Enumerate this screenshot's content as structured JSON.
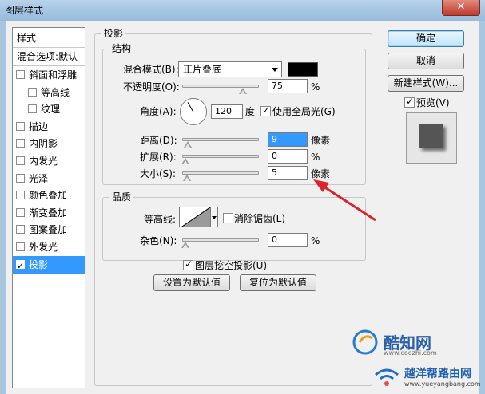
{
  "window": {
    "title": "图层样式",
    "close_label": "✕"
  },
  "sidebar": {
    "header": "样式",
    "blend_options": "混合选项:默认",
    "items": [
      {
        "label": "斜面和浮雕",
        "checked": false,
        "indent": false
      },
      {
        "label": "等高线",
        "checked": false,
        "indent": true
      },
      {
        "label": "纹理",
        "checked": false,
        "indent": true
      },
      {
        "label": "描边",
        "checked": false,
        "indent": false
      },
      {
        "label": "内阴影",
        "checked": false,
        "indent": false
      },
      {
        "label": "内发光",
        "checked": false,
        "indent": false
      },
      {
        "label": "光泽",
        "checked": false,
        "indent": false
      },
      {
        "label": "颜色叠加",
        "checked": false,
        "indent": false
      },
      {
        "label": "渐变叠加",
        "checked": false,
        "indent": false
      },
      {
        "label": "图案叠加",
        "checked": false,
        "indent": false
      },
      {
        "label": "外发光",
        "checked": false,
        "indent": false
      },
      {
        "label": "投影",
        "checked": true,
        "indent": false,
        "selected": true
      }
    ]
  },
  "drop_shadow": {
    "section_title": "投影",
    "structure": {
      "title": "结构",
      "blend_mode_label": "混合模式(B):",
      "blend_mode_value": "正片叠底",
      "blend_color": "#000000",
      "opacity_label": "不透明度(O):",
      "opacity_value": "75",
      "opacity_unit": "%",
      "opacity_level": 0.75,
      "angle_label": "角度(A):",
      "angle_value": "120",
      "angle_unit": "度",
      "global_light_label": "使用全局光(G)",
      "global_light_checked": true,
      "distance_label": "距离(D):",
      "distance_value": "9",
      "distance_unit": "像素",
      "distance_level": 0.03,
      "spread_label": "扩展(R):",
      "spread_value": "0",
      "spread_unit": "%",
      "spread_level": 0.0,
      "size_label": "大小(S):",
      "size_value": "5",
      "size_unit": "像素",
      "size_level": 0.02
    },
    "quality": {
      "title": "品质",
      "contour_label": "等高线:",
      "anti_alias_label": "消除锯齿(L)",
      "anti_alias_checked": false,
      "noise_label": "杂色(N):",
      "noise_value": "0",
      "noise_unit": "%",
      "noise_level": 0.0
    },
    "knockout_label": "图层挖空投影(U)",
    "knockout_checked": true,
    "make_default_label": "设置为默认值",
    "reset_default_label": "复位为默认值"
  },
  "buttons": {
    "ok": "确定",
    "cancel": "取消",
    "new_style": "新建样式(W)...",
    "preview_label": "预览(V)",
    "preview_checked": true
  },
  "watermark": {
    "site1": "酷知网",
    "site1_url": "www.coozhi.com",
    "site2": "越洋帮路由网",
    "site2_url": "www.yueyangbang.com"
  },
  "colors": {
    "selection": "#3399ff",
    "arrow": "#d9262c"
  }
}
